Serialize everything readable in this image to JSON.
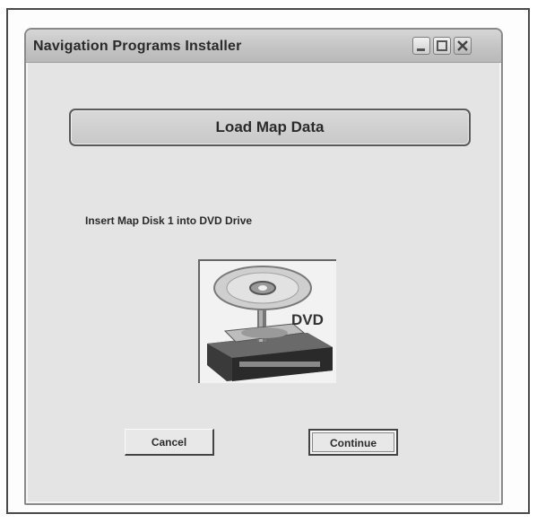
{
  "window": {
    "title": "Navigation Programs Installer"
  },
  "header": {
    "title": "Load Map Data"
  },
  "main": {
    "instruction": "Insert Map Disk 1 into DVD Drive",
    "image_label": "DVD",
    "image_icon": "dvd-drive-icon"
  },
  "buttons": {
    "cancel_label": "Cancel",
    "continue_label": "Continue"
  },
  "colors": {
    "window_bg": "#e4e4e4",
    "titlebar": "#c4c4c4",
    "border": "#5a5a5a"
  }
}
